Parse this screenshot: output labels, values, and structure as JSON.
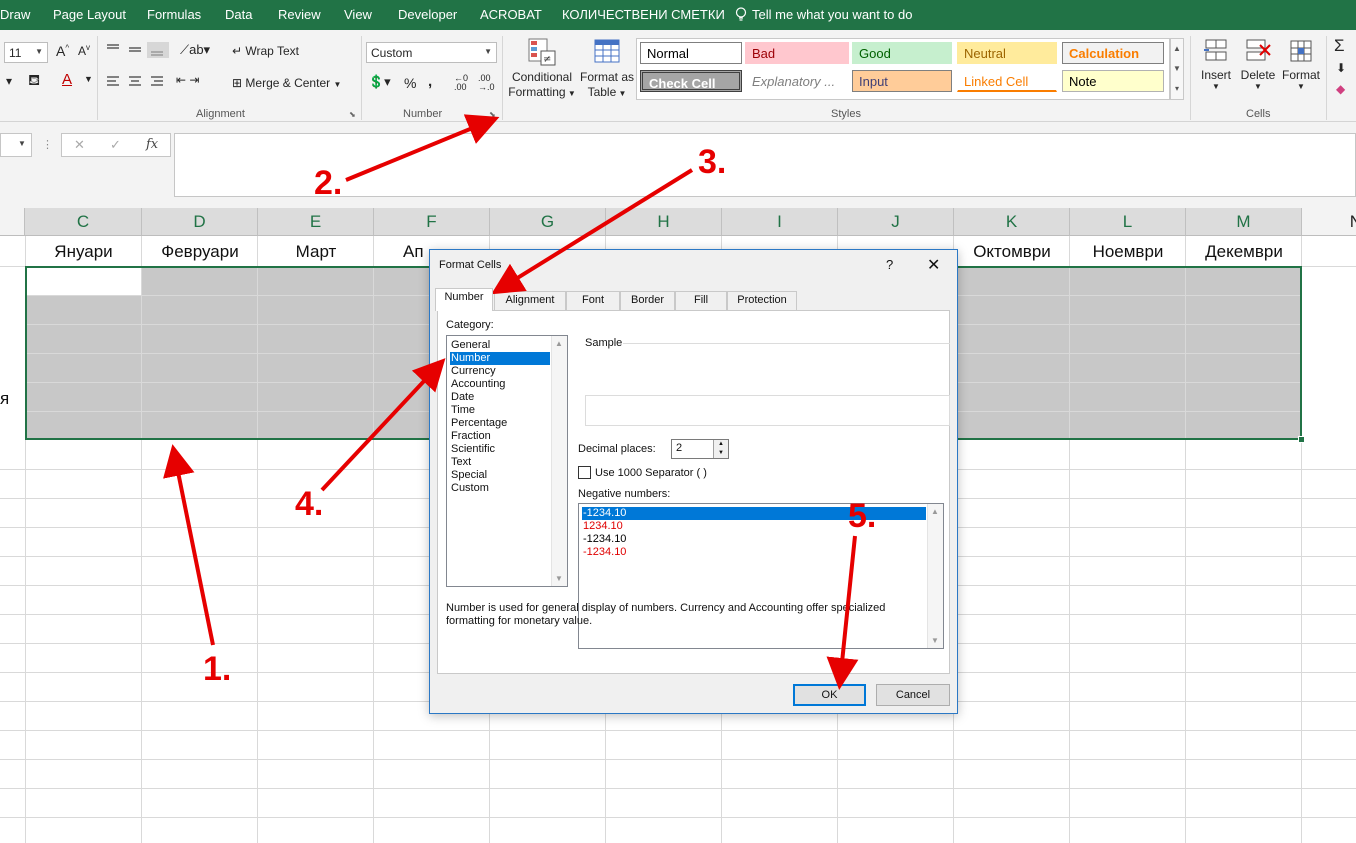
{
  "menu": {
    "items": [
      "Draw",
      "Page Layout",
      "Formulas",
      "Data",
      "Review",
      "View",
      "Developer",
      "ACROBAT",
      "КОЛИЧЕСТВЕНИ СМЕТКИ"
    ],
    "tell_me": "Tell me what you want to do"
  },
  "ribbon": {
    "font_size": "11",
    "wrap_text": "Wrap Text",
    "merge_center": "Merge & Center",
    "alignment_label": "Alignment",
    "number_format": "Custom",
    "number_label": "Number",
    "conditional_formatting": [
      "Conditional",
      "Formatting"
    ],
    "format_as_table": [
      "Format as",
      "Table"
    ],
    "styles_label": "Styles",
    "styles": [
      {
        "label": "Normal",
        "bg": "#ffffff",
        "fg": "#000000",
        "border": "#7f7f7f"
      },
      {
        "label": "Bad",
        "bg": "#ffc7ce",
        "fg": "#9c0006",
        "border": "#ffc7ce"
      },
      {
        "label": "Good",
        "bg": "#c6efce",
        "fg": "#006100",
        "border": "#c6efce"
      },
      {
        "label": "Neutral",
        "bg": "#ffeb9c",
        "fg": "#9c6500",
        "border": "#ffeb9c"
      },
      {
        "label": "Calculation",
        "bg": "#f2f2f2",
        "fg": "#fa7d00",
        "border": "#7f7f7f"
      },
      {
        "label": "Check Cell",
        "bg": "#a5a5a5",
        "fg": "#ffffff",
        "border": "#3f3f3f"
      },
      {
        "label": "Explanatory ...",
        "bg": "#ffffff",
        "fg": "#7f7f7f",
        "border": "#ffffff"
      },
      {
        "label": "Input",
        "bg": "#ffcc99",
        "fg": "#3f3f76",
        "border": "#7f7f7f"
      },
      {
        "label": "Linked Cell",
        "bg": "#ffffff",
        "fg": "#fa7d00",
        "border": "#ffffff"
      },
      {
        "label": "Note",
        "bg": "#ffffcc",
        "fg": "#000000",
        "border": "#b2b2b2"
      }
    ],
    "insert": "Insert",
    "delete": "Delete",
    "format": "Format",
    "cells_label": "Cells"
  },
  "formula_bar": {
    "cancel": "✕",
    "enter": "✓",
    "fx": "fx"
  },
  "sheet": {
    "columns": [
      "C",
      "D",
      "E",
      "F",
      "G",
      "H",
      "I",
      "J",
      "K",
      "L",
      "M",
      "N"
    ],
    "months": [
      "Януари",
      "Февруари",
      "Март",
      "Ап",
      "Октомври",
      "Ноември",
      "Декември"
    ],
    "row_stub": "я"
  },
  "dialog": {
    "title": "Format Cells",
    "help": "?",
    "close": "✕",
    "tabs": [
      "Number",
      "Alignment",
      "Font",
      "Border",
      "Fill",
      "Protection"
    ],
    "category_label": "Category:",
    "categories": [
      "General",
      "Number",
      "Currency",
      "Accounting",
      "Date",
      "Time",
      "Percentage",
      "Fraction",
      "Scientific",
      "Text",
      "Special",
      "Custom"
    ],
    "selected_category": "Number",
    "sample_label": "Sample",
    "decimal_label": "Decimal places:",
    "decimal_value": "2",
    "separator_label": "Use 1000 Separator ( )",
    "negative_label": "Negative numbers:",
    "negatives": [
      {
        "text": "-1234.10",
        "color": "#ffffff",
        "selected": true
      },
      {
        "text": "1234.10",
        "color": "#e00000",
        "selected": false
      },
      {
        "text": "-1234.10",
        "color": "#000000",
        "selected": false
      },
      {
        "text": "-1234.10",
        "color": "#e00000",
        "selected": false
      }
    ],
    "description_1": "Number is used for general display of numbers.  Currency and Accounting offer specialized",
    "description_2": "formatting for monetary value.",
    "ok": "OK",
    "cancel": "Cancel"
  },
  "annotations": [
    "1.",
    "2.",
    "3.",
    "4.",
    "5."
  ],
  "colors": {
    "excel_green": "#217346",
    "selection_gray": "#c8c8c8",
    "highlight_blue": "#0078d7",
    "annotation_red": "#e60000"
  }
}
